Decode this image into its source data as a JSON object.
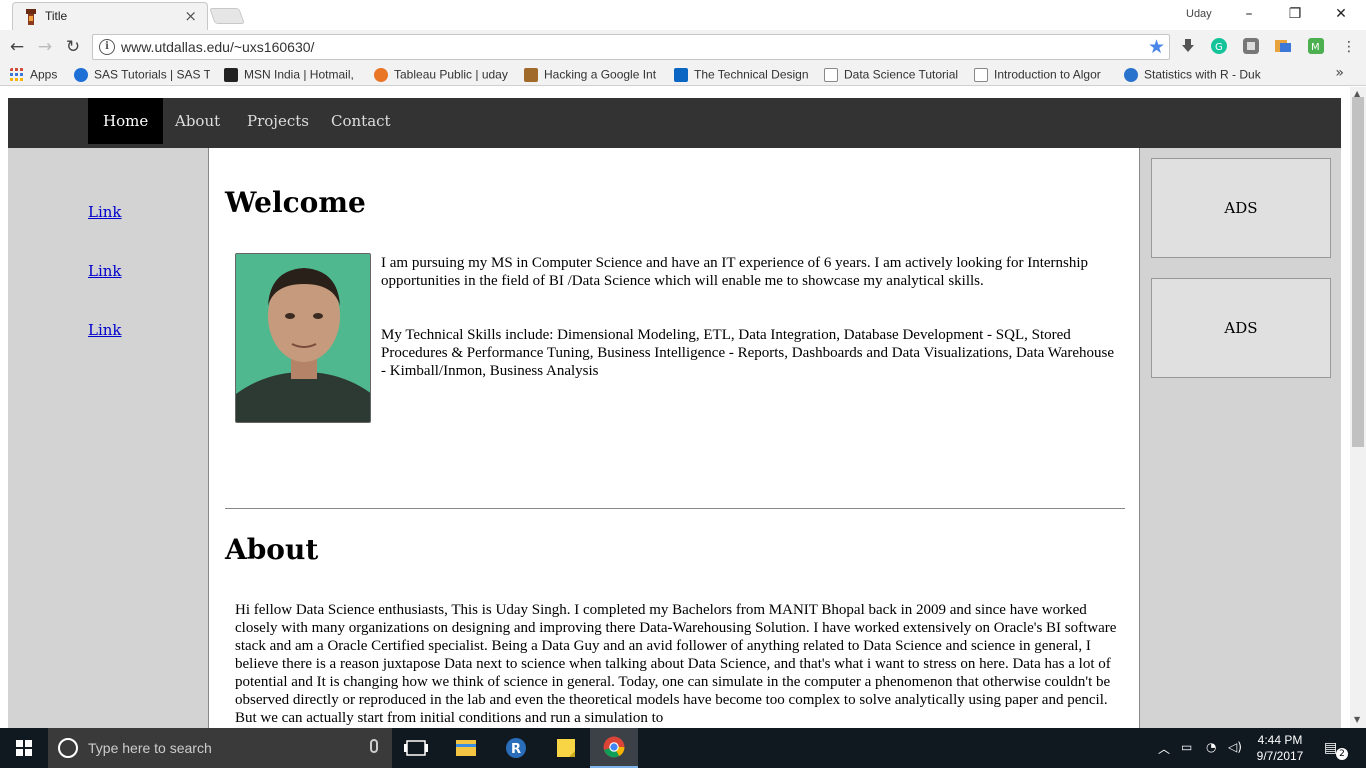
{
  "browser": {
    "tab_title": "Title",
    "tab_close": "×",
    "profile_name": "Uday",
    "url": "www.utdallas.edu/~uxs160630/",
    "window_controls": {
      "minimize": "–",
      "restore": "❐",
      "close": "✕"
    },
    "nav": {
      "back": "←",
      "forward": "→",
      "reload": "↻"
    },
    "bookmark_star": "★",
    "bookmarks": [
      {
        "label": "Apps",
        "icon": "apps-grid-icon",
        "color": "#e0e0e0"
      },
      {
        "label": "SAS Tutorials | SAS Tr",
        "icon": "sas-icon",
        "color": "#1e6fd6"
      },
      {
        "label": "MSN India | Hotmail,",
        "icon": "msn-icon",
        "color": "#222222"
      },
      {
        "label": "Tableau Public | uday",
        "icon": "tableau-icon",
        "color": "#e97627"
      },
      {
        "label": "Hacking a Google Int",
        "icon": "hacking-icon",
        "color": "#a06a2a"
      },
      {
        "label": "The Technical Design",
        "icon": "linkedin-icon",
        "color": "#0a66c2"
      },
      {
        "label": "Data Science Tutorial",
        "icon": "page-icon",
        "color": "#ffffff"
      },
      {
        "label": "Introduction to Algor",
        "icon": "page-icon",
        "color": "#ffffff"
      },
      {
        "label": "Statistics with R - Duk",
        "icon": "coursera-icon",
        "color": "#2a73cc"
      }
    ],
    "bookmarks_overflow": "»"
  },
  "site": {
    "nav": [
      {
        "label": "Home",
        "active": true
      },
      {
        "label": "About",
        "active": false
      },
      {
        "label": "Projects",
        "active": false
      },
      {
        "label": "Contact",
        "active": false
      }
    ],
    "sidebar_links": [
      "Link",
      "Link",
      "Link"
    ],
    "ads": [
      "ADS",
      "ADS"
    ],
    "welcome": {
      "heading": "Welcome",
      "intro": "I am pursuing my MS in Computer Science and have an IT experience of 6 years. I am actively looking for Internship opportunities in the field of BI /Data Science which will enable me to showcase my analytical skills.",
      "skills": "My Technical Skills include: Dimensional Modeling, ETL, Data Integration, Database Development - SQL, Stored Procedures & Performance Tuning, Business Intelligence - Reports, Dashboards and Data Visualizations, Data Warehouse - Kimball/Inmon, Business Analysis"
    },
    "about": {
      "heading": "About",
      "text": "Hi fellow Data Science enthusiasts, This is Uday Singh. I completed my Bachelors from MANIT Bhopal back in 2009 and since have worked closely with many organizations on designing and improving there Data-Warehousing Solution. I have worked extensively on Oracle's BI software stack and am a Oracle Certified specialist. Being a Data Guy and an avid follower of anything related to Data Science and science in general, I believe there is a reason juxtapose Data next to science when talking about Data Science, and that's what i want to stress on here. Data has a lot of potential and It is changing how we think of science in general. Today, one can simulate in the computer a phenomenon that otherwise couldn't be observed directly or reproduced in the lab and even the theoretical models have become too complex to solve analytically using paper and pencil. But we can actually start from initial conditions and run a simulation to"
    }
  },
  "taskbar": {
    "search_placeholder": "Type here to search",
    "time": "4:44 PM",
    "date": "9/7/2017",
    "notifications": "2"
  }
}
